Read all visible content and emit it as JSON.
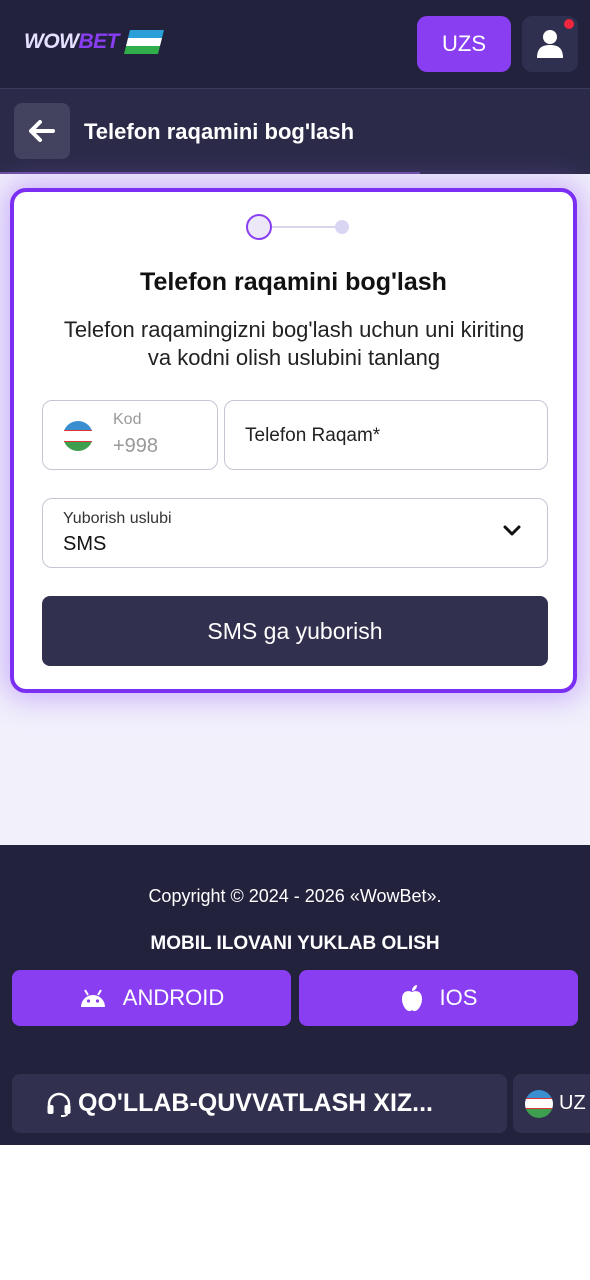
{
  "header": {
    "logo_wow": "WOW",
    "logo_bet": "BET",
    "currency_label": "UZS",
    "icons": {
      "user": "user-icon",
      "flag": "uzbekistan-flag-icon"
    }
  },
  "subheader": {
    "title": "Telefon raqamini bog'lash",
    "back_icon": "arrow-left-icon"
  },
  "card": {
    "title": "Telefon raqamini bog'lash",
    "description": "Telefon raqamingizni bog'lash uchun uni kiriting va kodni olish uslubini tanlang",
    "code_field": {
      "label": "Kod",
      "value": "+998"
    },
    "phone_field": {
      "placeholder": "Telefon Raqam*"
    },
    "method_field": {
      "label": "Yuborish uslubi",
      "value": "SMS"
    },
    "submit_label": "SMS ga yuborish",
    "stepper": {
      "current": 1,
      "total": 2
    }
  },
  "footer": {
    "copyright": "Copyright © 2024 - 2026 «WowBet».",
    "mobile_title": "MOBIL ILOVANI YUKLAB OLISH",
    "android_label": "ANDROID",
    "ios_label": "IOS",
    "support_label": "QO'LLAB-QUVVATLASH XIZ...",
    "language_label": "UZ"
  },
  "colors": {
    "accent": "#8a3ef2",
    "header_bg": "#22223d",
    "dark_button": "#31314f",
    "notification": "#f0263e"
  }
}
